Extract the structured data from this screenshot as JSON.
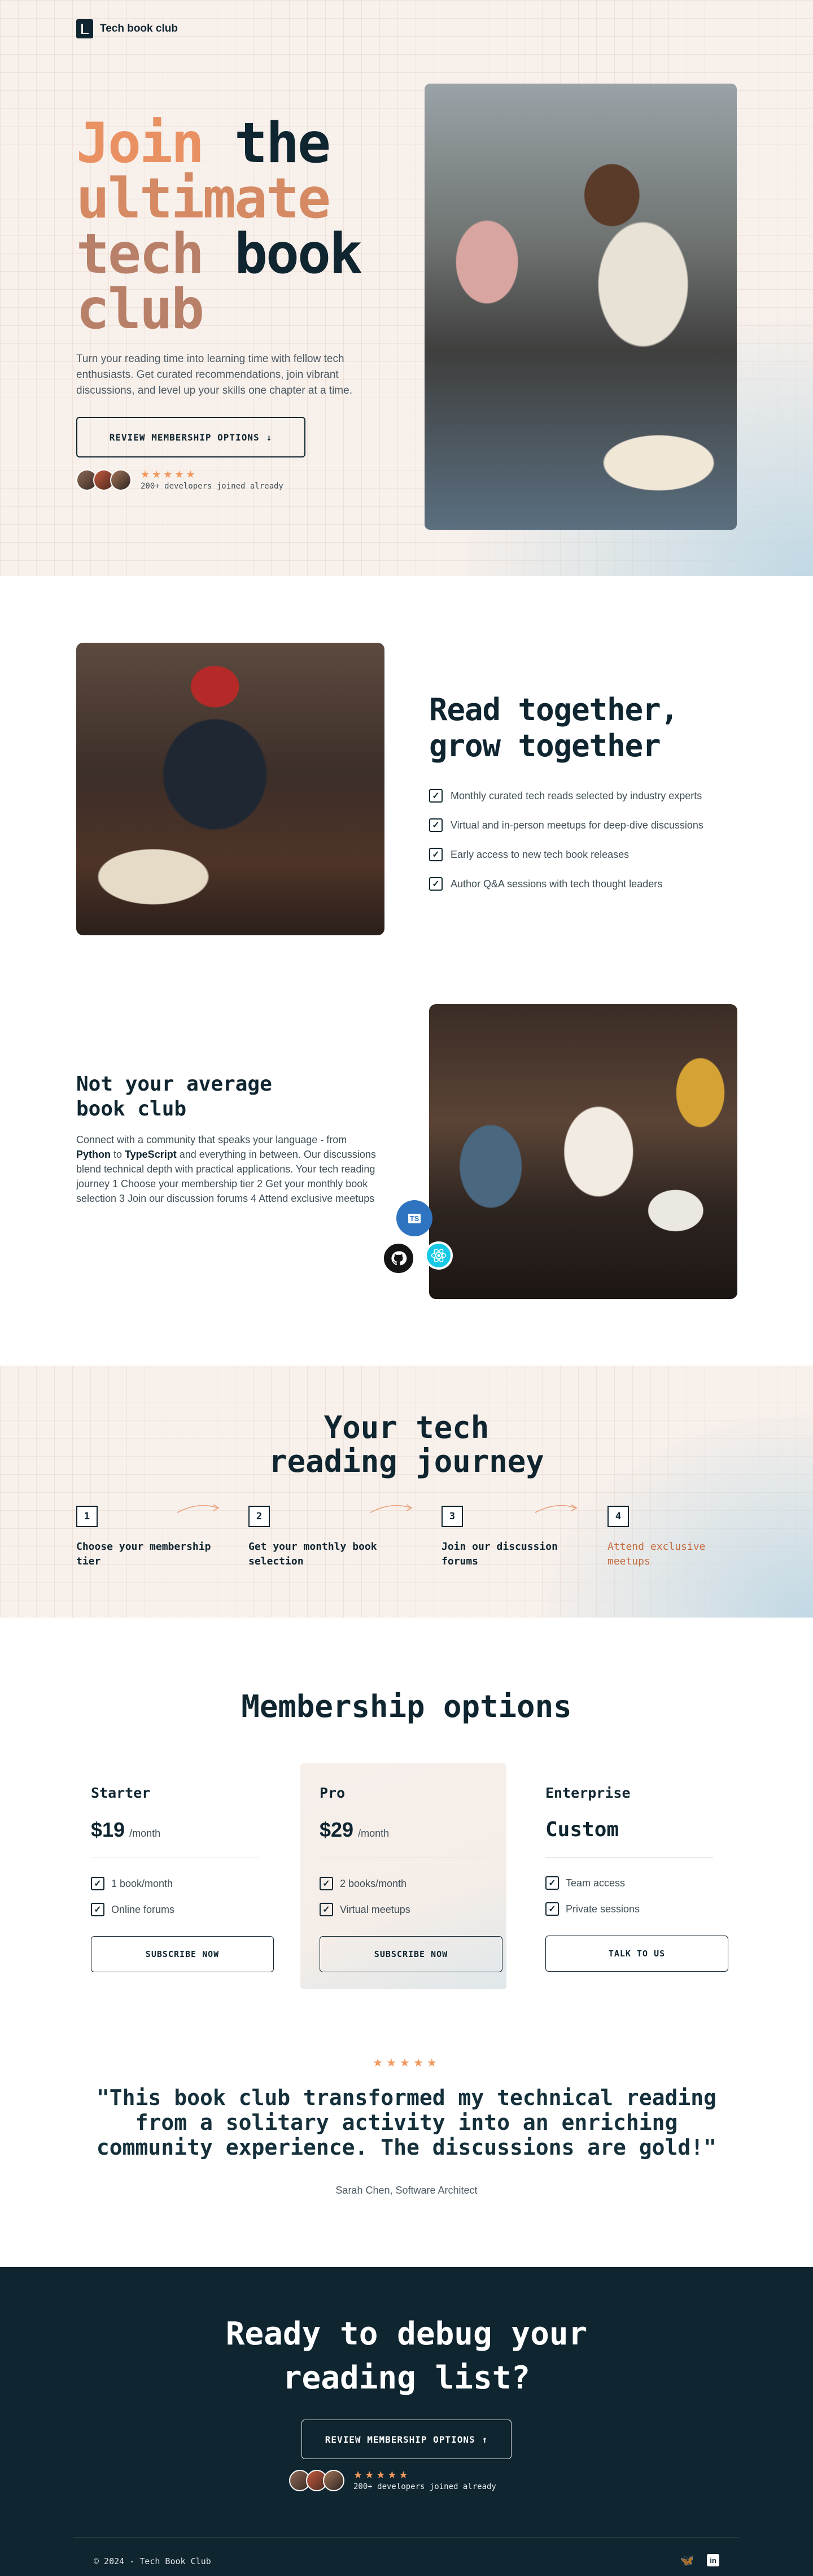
{
  "brand": {
    "name": "Tech book club"
  },
  "hero": {
    "title_words": [
      "Join",
      "the",
      "ultimate",
      "tech",
      "book",
      "club"
    ],
    "subtitle": "Turn your reading time into learning time with fellow tech enthusiasts. Get curated recommendations, join vibrant discussions, and level up your skills one chapter at a time.",
    "cta_label": "REVIEW MEMBERSHIP OPTIONS",
    "stars": "★★★★★",
    "joined_text": "200+ developers joined already"
  },
  "features": {
    "title_line1": "Read together,",
    "title_line2": "grow together",
    "items": [
      "Monthly curated tech reads selected by industry experts",
      "Virtual and in-person meetups for deep-dive discussions",
      "Early access to new tech book releases",
      "Author Q&A sessions with tech thought leaders"
    ]
  },
  "community": {
    "title_line1": "Not your average",
    "title_line2": "book club",
    "text_a": "Connect with a community that speaks your language - from ",
    "python": "Python",
    "text_b": " to ",
    "typescript": "TypeScript",
    "text_c": " and everything in between. Our discussions blend technical depth with practical applications. Your tech reading journey 1 Choose your membership tier 2 Get your monthly book selection 3 Join our discussion forums 4 Attend exclusive meetups",
    "badges": {
      "ts": "TS",
      "github": "github-icon",
      "react": "react-icon"
    }
  },
  "journey": {
    "title_line1": "Your tech",
    "title_line2": "reading journey",
    "steps": [
      {
        "num": "1",
        "label": "Choose your membership tier"
      },
      {
        "num": "2",
        "label": "Get your monthly book selection"
      },
      {
        "num": "3",
        "label": "Join our discussion forums"
      },
      {
        "num": "4",
        "label": "Attend exclusive meetups"
      }
    ]
  },
  "membership": {
    "title": "Membership options",
    "plans": [
      {
        "name": "Starter",
        "price": "$19",
        "period": "/month",
        "features": [
          "1 book/month",
          "Online forums"
        ],
        "cta": "SUBSCRIBE NOW"
      },
      {
        "name": "Pro",
        "price": "$29",
        "period": "/month",
        "features": [
          "2 books/month",
          "Virtual meetups"
        ],
        "cta": "SUBSCRIBE NOW"
      },
      {
        "name": "Enterprise",
        "price": "Custom",
        "period": "",
        "features": [
          "Team access",
          "Private sessions"
        ],
        "cta": "TALK TO US"
      }
    ]
  },
  "testimonial": {
    "stars": "★★★★★",
    "quote": "\"This book club transformed my technical reading from a solitary activity into an enriching community experience. The discussions are gold!\"",
    "author": "Sarah Chen, Software Architect"
  },
  "cta": {
    "title_line1": "Ready to debug your",
    "title_line2": "reading list?",
    "button_label": "REVIEW MEMBERSHIP OPTIONS",
    "stars": "★★★★★",
    "joined_text": "200+ developers joined already"
  },
  "footer": {
    "copyright": "© 2024 - Tech Book Club",
    "social_icons": [
      "bluesky-icon",
      "linkedin-icon"
    ]
  },
  "colors": {
    "navy": "#0f2530",
    "accent": "#e99162",
    "cream": "#f8f0eb",
    "star": "#f2985e"
  }
}
